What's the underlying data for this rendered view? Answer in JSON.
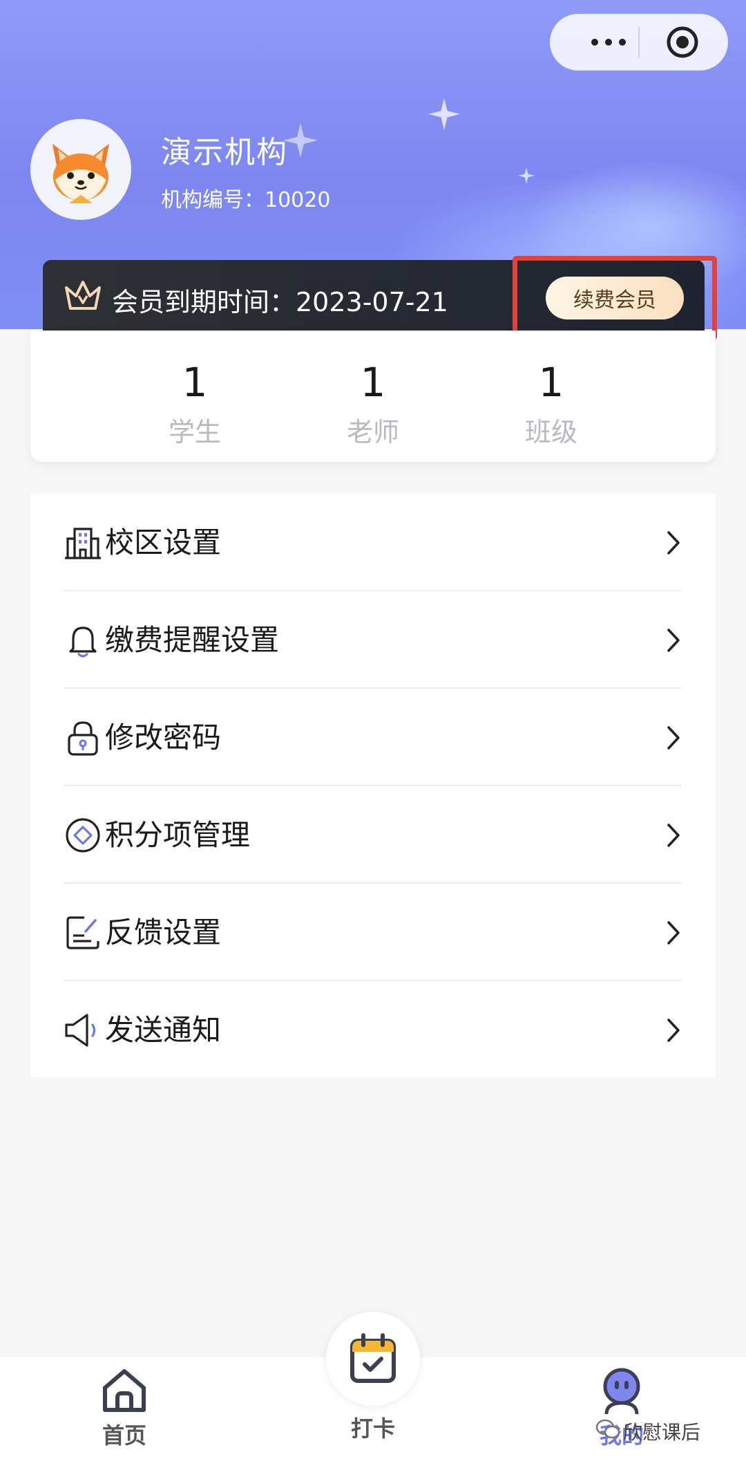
{
  "header": {
    "org_name": "演示机构",
    "org_code": "机构编号：10020"
  },
  "member": {
    "expire_label": "会员到期时间：2023-07-21",
    "renew_label": "续费会员"
  },
  "stats": [
    {
      "num": "1",
      "label": "学生"
    },
    {
      "num": "1",
      "label": "老师"
    },
    {
      "num": "1",
      "label": "班级"
    }
  ],
  "menu": [
    {
      "label": "校区设置",
      "icon": "building-icon"
    },
    {
      "label": "缴费提醒设置",
      "icon": "bell-icon"
    },
    {
      "label": "修改密码",
      "icon": "lock-icon"
    },
    {
      "label": "积分项管理",
      "icon": "diamond-badge-icon"
    },
    {
      "label": "反馈设置",
      "icon": "feedback-edit-icon"
    },
    {
      "label": "发送通知",
      "icon": "speaker-icon"
    }
  ],
  "tabbar": {
    "home": "首页",
    "checkin": "打卡",
    "mine": "我的"
  },
  "watermark": "欣慰课后",
  "colors": {
    "header": "#8e9bf7",
    "accent": "#6d78e8",
    "highlight": "#e4413b"
  }
}
